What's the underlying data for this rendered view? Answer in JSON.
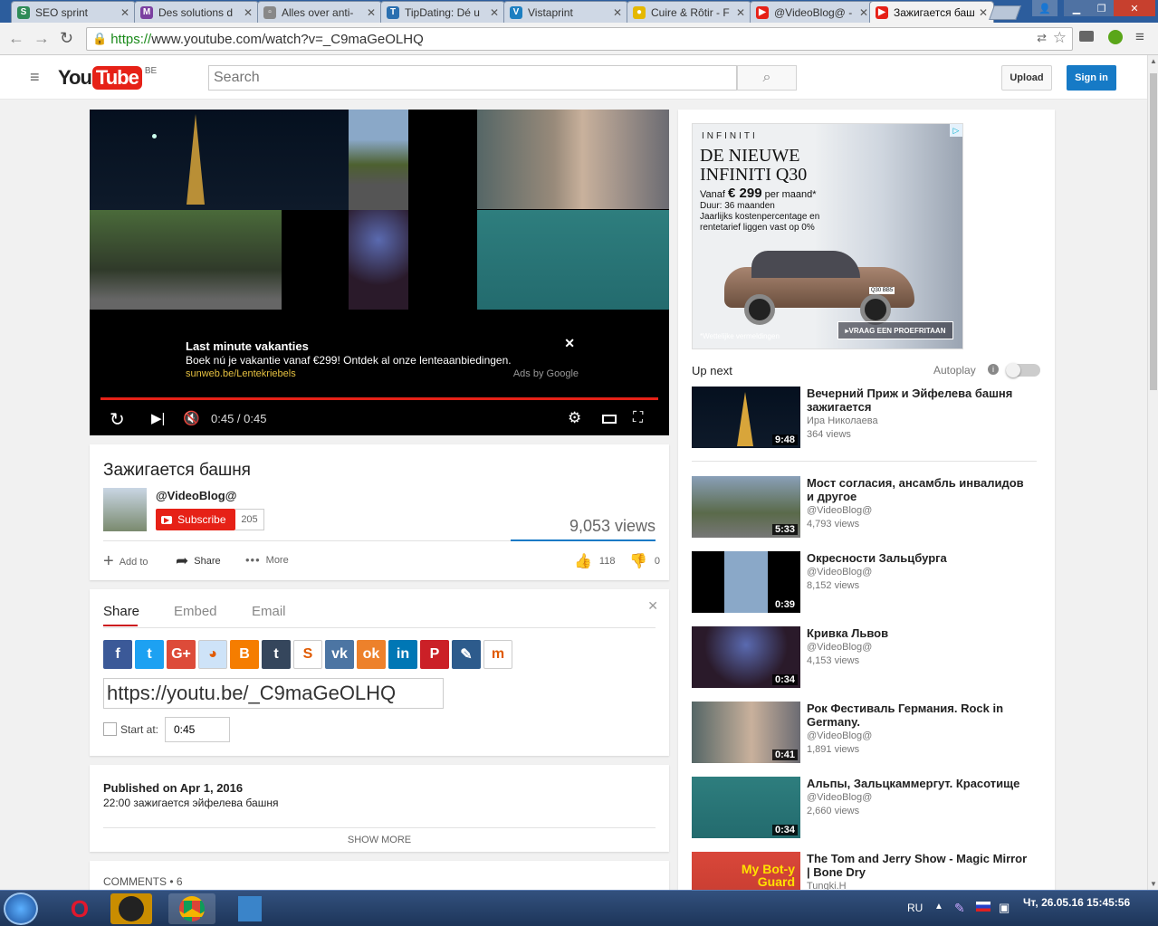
{
  "browser": {
    "tabs": [
      {
        "title": "SEO sprint",
        "color": "#2e8b57",
        "glyph": "S"
      },
      {
        "title": "Des solutions d",
        "color": "#7b3fa0",
        "glyph": "M"
      },
      {
        "title": "Alles over anti-",
        "color": "#888888",
        "glyph": "▫"
      },
      {
        "title": "TipDating: Dé u",
        "color": "#2a6fb0",
        "glyph": "T"
      },
      {
        "title": "Vistaprint",
        "color": "#1d7fc1",
        "glyph": "V"
      },
      {
        "title": "Cuire & Rôtir - F",
        "color": "#e5b800",
        "glyph": "●"
      },
      {
        "title": "@VideoBlog@ -",
        "color": "#e62117",
        "glyph": "▶"
      },
      {
        "title": "Зажигается баш",
        "color": "#e62117",
        "glyph": "▶"
      }
    ],
    "url_scheme": "https://",
    "url_rest": "www.youtube.com/watch?v=_C9maGeOLHQ"
  },
  "header": {
    "logo_you": "You",
    "logo_tube": "Tube",
    "region": "BE",
    "search_placeholder": "Search",
    "upload_label": "Upload",
    "signin_label": "Sign in"
  },
  "player": {
    "ad_title": "Last minute vakanties",
    "ad_text": "Boek nú je vakantie vanaf €299! Ontdek al onze lenteaanbiedingen.",
    "ad_url": "sunweb.be/Lentekriebels",
    "ad_by": "Ads by Google",
    "time": "0:45 / 0:45",
    "progress": 1.0
  },
  "video": {
    "title": "Зажигается башня",
    "channel": "@VideoBlog@",
    "subscribe_label": "Subscribe",
    "subscriber_count": "205",
    "views": "9,053 views",
    "add_to_label": "Add to",
    "share_label": "Share",
    "more_label": "More",
    "likes": "118",
    "dislikes": "0",
    "like_ratio": 1.0
  },
  "share_panel": {
    "tabs": [
      "Share",
      "Embed",
      "Email"
    ],
    "networks": [
      {
        "name": "facebook-icon",
        "glyph": "f",
        "color": "#3b5998"
      },
      {
        "name": "twitter-icon",
        "glyph": "t",
        "color": "#1da1f2"
      },
      {
        "name": "googleplus-icon",
        "glyph": "G+",
        "color": "#dd4b39"
      },
      {
        "name": "reddit-icon",
        "glyph": "◕",
        "color": "#cee3f8"
      },
      {
        "name": "blogger-icon",
        "glyph": "B",
        "color": "#f57d00"
      },
      {
        "name": "tumblr-icon",
        "glyph": "t",
        "color": "#35465c"
      },
      {
        "name": "stumbleupon-icon",
        "glyph": "S",
        "color": "#ffffff"
      },
      {
        "name": "vk-icon",
        "glyph": "vk",
        "color": "#4c75a3"
      },
      {
        "name": "odnoklassniki-icon",
        "glyph": "ok",
        "color": "#ed812b"
      },
      {
        "name": "linkedin-icon",
        "glyph": "in",
        "color": "#0077b5"
      },
      {
        "name": "pinterest-icon",
        "glyph": "P",
        "color": "#cb2027"
      },
      {
        "name": "livejournal-icon",
        "glyph": "✎",
        "color": "#2d5b8c"
      },
      {
        "name": "mixi-icon",
        "glyph": "m",
        "color": "#ffffff"
      }
    ],
    "share_url": "https://youtu.be/_C9maGeOLHQ",
    "start_at_label": "Start at:",
    "start_at_value": "0:45"
  },
  "description": {
    "published": "Published on Apr 1, 2016",
    "text": "22:00 зажигается эйфелева башня",
    "show_more": "SHOW MORE"
  },
  "comments": {
    "label": "COMMENTS • 6"
  },
  "ad_banner": {
    "brand": "INFINITI",
    "headline_1": "DE NIEUWE",
    "headline_2": "INFINITI Q30",
    "price_prefix": "Vanaf",
    "price": "€ 299",
    "price_suffix": "per maand*",
    "line_1": "Duur: 36 maanden",
    "line_2": "Jaarlijks kostenpercentage en",
    "line_3": "rentetarief liggen vast op 0%",
    "legal": "*Wettelijke vermeldingen",
    "cta": "VRAAG EEN PROEFRITAAN",
    "plate": "Q30 BB5"
  },
  "sidebar": {
    "upnext_label": "Up next",
    "autoplay_label": "Autoplay",
    "videos": [
      {
        "title": "Вечерний Приж и Эйфелева башня зажигается",
        "channel": "Ира Николаева",
        "views": "364 views",
        "duration": "9:48"
      },
      {
        "title": "Мост согласия, ансамбль инвалидов и другое",
        "channel": "@VideoBlog@",
        "views": "4,793 views",
        "duration": "5:33"
      },
      {
        "title": "Окресности Зальцбурга",
        "channel": "@VideoBlog@",
        "views": "8,152 views",
        "duration": "0:39"
      },
      {
        "title": "Кривка Львов",
        "channel": "@VideoBlog@",
        "views": "4,153 views",
        "duration": "0:34"
      },
      {
        "title": "Рок Фестиваль Германия. Rock in Germany.",
        "channel": "@VideoBlog@",
        "views": "1,891 views",
        "duration": "0:41"
      },
      {
        "title": "Альпы, Зальцкаммергут. Красотище",
        "channel": "@VideoBlog@",
        "views": "2,660 views",
        "duration": "0:34"
      },
      {
        "title": "The Tom and Jerry Show - Magic Mirror | Bone Dry",
        "channel": "Tungki.H",
        "views": "",
        "duration": ""
      }
    ],
    "last_thumb_text": "My Bot-y Guard"
  },
  "taskbar": {
    "lang": "RU",
    "clock": "Чт, 26.05.16 15:45:56"
  }
}
